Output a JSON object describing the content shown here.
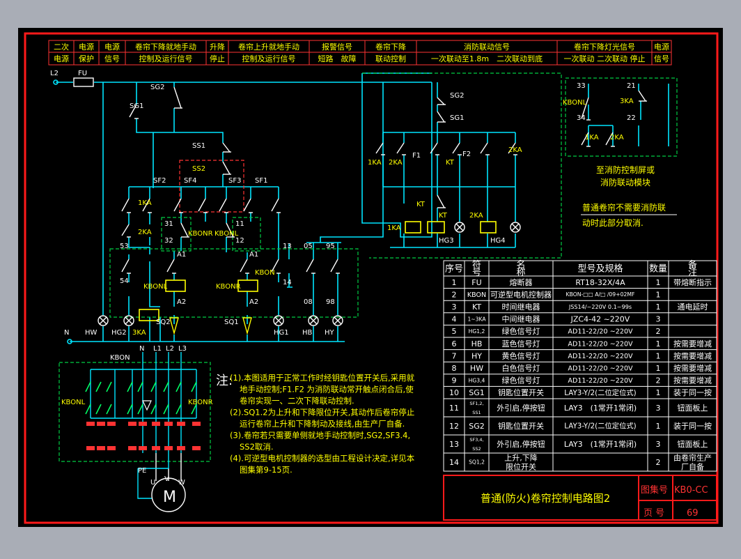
{
  "colors": {
    "background": "#a9adb6",
    "canvas": "#000000",
    "border": "#ff1a1a",
    "wire": "#00e5ff",
    "component": "#ffff00",
    "label": "#ffffff",
    "table_text": "#ffffff",
    "note_text": "#ffff00",
    "dashed": "#00cc44",
    "coil": "#ff3333",
    "accent_green": "#00ff66"
  },
  "header": {
    "cells": [
      {
        "top": "二次",
        "bottom": "电源"
      },
      {
        "top": "电源",
        "bottom": "保护"
      },
      {
        "top": "电源",
        "bottom": "信号"
      },
      {
        "top": "卷帘下降就地手动",
        "bottom": "控制及运行信号"
      },
      {
        "top": "升降",
        "bottom": "停止"
      },
      {
        "top": "卷帘上升就地手动",
        "bottom": "控制及运行信号"
      },
      {
        "top": "报警信号",
        "bottom": "短路　故障"
      },
      {
        "top": "卷帘下降",
        "bottom": "联动控制"
      },
      {
        "top": "消防联动信号",
        "bottom": "一次联动至1.8m　二次联动到底"
      },
      {
        "top": "卷帘下降灯光信号",
        "bottom": "一次联动 二次联动 停止"
      },
      {
        "top": "电源",
        "bottom": "信号"
      }
    ]
  },
  "labels": {
    "L2": "L2",
    "FU": "FU",
    "N": "N",
    "SG2_left": "SG2",
    "SG1_left": "SG1",
    "SS1": "SS1",
    "SS2": "SS2",
    "SF2": "SF2",
    "SF4": "SF4",
    "SF3": "SF3",
    "SF1": "SF1",
    "1KA_a": "1KA",
    "2KA_a": "2KA",
    "KBONR_a": "KBONR",
    "KBONL_a": "KBONL",
    "n31": "31",
    "n32": "32",
    "n11": "11",
    "n12": "12",
    "n53": "53",
    "n54": "54",
    "n13": "13",
    "n14": "14",
    "n05": "05",
    "n95": "95",
    "n08": "08",
    "n98": "98",
    "A1a": "A1",
    "A2a": "A2",
    "A1b": "A1",
    "A2b": "A2",
    "KBONL_coil": "KBONL",
    "KBONR_coil": "KBONR",
    "KBON": "KBON",
    "HW": "HW",
    "HG2": "HG2",
    "3KA": "3KA",
    "SQ2": "SQ2",
    "SQ1": "SQ1",
    "HG1": "HG1",
    "HB": "HB",
    "HY": "HY",
    "SG2_right": "SG2",
    "SG1_right": "SG1",
    "1KA_b": "1KA",
    "2KA_b": "2KA",
    "F1": "F1",
    "KT_a": "KT",
    "F2": "F2",
    "2KA_c": "2KA",
    "KT_b": "KT",
    "KT_c": "KT",
    "1KA_coil": "1KA",
    "2KA_coil": "2KA",
    "HG3": "HG3",
    "HG4": "HG4",
    "n33": "33",
    "n34": "34",
    "n21": "21",
    "n22": "22",
    "KBONL_r": "KBONL",
    "3KA_r": "3KA",
    "1KA_r": "1KA",
    "2KA_r": "2KA",
    "fire_note1": "至消防控制屏或",
    "fire_note2": "消防联动模块",
    "fire_note3": "普通卷帘不需要消防联",
    "fire_note4": "动时此部分取消.",
    "motor_KBON": "KBON",
    "motor_N": "N",
    "motor_L1": "L1",
    "motor_L2": "L2",
    "motor_L3": "L3",
    "motor_KBONL": "KBONL",
    "motor_KBONR": "KBONR",
    "PE": "PE",
    "U": "U",
    "V": "V",
    "W": "W",
    "M": "M"
  },
  "notes": {
    "title": "注:",
    "lines": [
      "(1).本图适用于正常工作时经钥匙位置开关后,采用就",
      "地手动控制;F1.F2 为消防联动常开触点闭合后,使",
      "卷帘实现一、二次下降联动控制.",
      "(2).SQ1.2为上升和下降限位开关,其动作后卷帘停止",
      "运行卷帘上升和下降制动及接线,由生产厂自备.",
      "(3).卷帘若只需要单侧就地手动控制时,SG2,SF3.4,",
      "SS2取消.",
      "(4).可逆型电机控制器的选型由工程设计决定,详见本",
      "图集第9-15页."
    ]
  },
  "table": {
    "headers": [
      "序号",
      "符 号",
      "名 称",
      "型号及规格",
      "数量",
      "备 注"
    ],
    "rows": [
      [
        "1",
        "FU",
        "熔断器",
        "RT18-32X/4A",
        "1",
        "带熔断指示"
      ],
      [
        "2",
        "KBON",
        "可逆型电机控制器",
        "KBON-□□ A/□ /09+02MF",
        "1",
        ""
      ],
      [
        "3",
        "KT",
        "时间继电器",
        "JSS14/~220V 0.1~99s",
        "1",
        "通电延时"
      ],
      [
        "4",
        "1~3KA",
        "中间继电器",
        "JZC4-42 ~220V",
        "3",
        ""
      ],
      [
        "5",
        "HG1,2",
        "绿色信号灯",
        "AD11-22/20 ~220V",
        "2",
        ""
      ],
      [
        "6",
        "HB",
        "蓝色信号灯",
        "AD11-22/20 ~220V",
        "1",
        "按需要增减"
      ],
      [
        "7",
        "HY",
        "黄色信号灯",
        "AD11-22/20 ~220V",
        "1",
        "按需要增减"
      ],
      [
        "8",
        "HW",
        "白色信号灯",
        "AD11-22/20 ~220V",
        "1",
        "按需要增减"
      ],
      [
        "9",
        "HG3,4",
        "绿色信号灯",
        "AD11-22/20 ~220V",
        "2",
        "按需要增减"
      ],
      [
        "10",
        "SG1",
        "钥匙位置开关",
        "LAY3-Y/2(二位定位式)",
        "1",
        "装于同一按"
      ],
      [
        "11",
        "SF1,2, SS1",
        "外引启,停按钮",
        "LAY3　(1常开1常闭)",
        "3",
        "钮面板上"
      ],
      [
        "12",
        "SG2",
        "钥匙位置开关",
        "LAY3-Y/2(二位定位式)",
        "1",
        "装于同一按"
      ],
      [
        "13",
        "SF3,4, SS2",
        "外引启,停按钮",
        "LAY3　(1常开1常闭)",
        "3",
        "钮面板上"
      ],
      [
        "14",
        "SQ1,2",
        "上升,下降 限位开关",
        "",
        "2",
        "由卷帘生产 厂自备"
      ]
    ]
  },
  "title_block": {
    "title": "普通(防火)卷帘控制电路图2",
    "atlas_label": "图集号",
    "atlas_value": "KB0-CC",
    "page_label": "页 号",
    "page_value": "69"
  }
}
